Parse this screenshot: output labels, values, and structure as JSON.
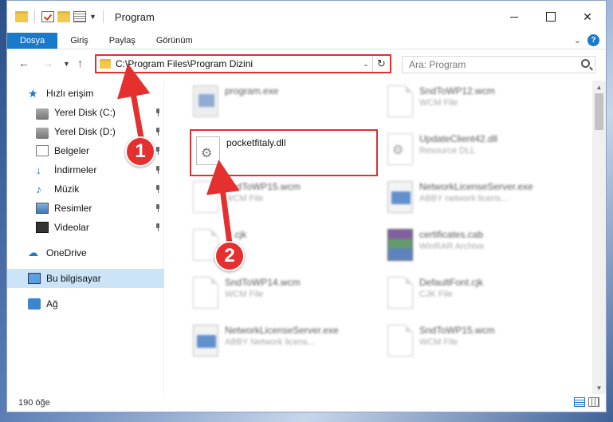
{
  "window": {
    "title": "Program"
  },
  "ribbon": {
    "tabs": [
      "Dosya",
      "Giriş",
      "Paylaş",
      "Görünüm"
    ]
  },
  "address": {
    "path": "C:\\Program Files\\Program Dizini",
    "search_placeholder": "Ara: Program"
  },
  "nav": {
    "items": [
      {
        "label": "Hızlı erişim",
        "icon": "star-icon"
      },
      {
        "label": "Yerel Disk (C:)",
        "icon": "disk-icon"
      },
      {
        "label": "Yerel Disk (D:)",
        "icon": "disk-icon"
      },
      {
        "label": "Belgeler",
        "icon": "documents-icon"
      },
      {
        "label": "İndirmeler",
        "icon": "download-icon"
      },
      {
        "label": "Müzik",
        "icon": "music-icon"
      },
      {
        "label": "Resimler",
        "icon": "pictures-icon"
      },
      {
        "label": "Videolar",
        "icon": "videos-icon"
      },
      {
        "label": "OneDrive",
        "icon": "cloud-icon"
      },
      {
        "label": "Bu bilgisayar",
        "icon": "computer-icon"
      },
      {
        "label": "Ağ",
        "icon": "network-icon"
      }
    ]
  },
  "files": {
    "highlighted": {
      "name": "pocketfitaly.dll"
    },
    "left": [
      {
        "name": "program.exe",
        "type": ""
      },
      {
        "name": "SndToWP15.wcm",
        "type": "WCM File"
      },
      {
        "name": "dl.cjk",
        "type": ""
      },
      {
        "name": "SndToWP14.wcm",
        "type": "WCM File"
      },
      {
        "name": "NetworkLicenseServer.exe",
        "type": "ABBY Network licens..."
      }
    ],
    "right": [
      {
        "name": "SndToWP12.wcm",
        "type": "WCM File"
      },
      {
        "name": "UpdateClient42.dll",
        "type": "Resource DLL"
      },
      {
        "name": "NetworkLicenseServer.exe",
        "type": "ABBY network licens..."
      },
      {
        "name": "certificates.cab",
        "type": "WinRAR Archive"
      },
      {
        "name": "DefaultFont.cjk",
        "type": "CJK File"
      },
      {
        "name": "SndToWP15.wcm",
        "type": "WCM File"
      }
    ]
  },
  "status": {
    "count": "190 öğe"
  },
  "annotations": {
    "step1": "1",
    "step2": "2"
  },
  "colors": {
    "accent": "#1979ca",
    "highlight": "#e03030"
  }
}
